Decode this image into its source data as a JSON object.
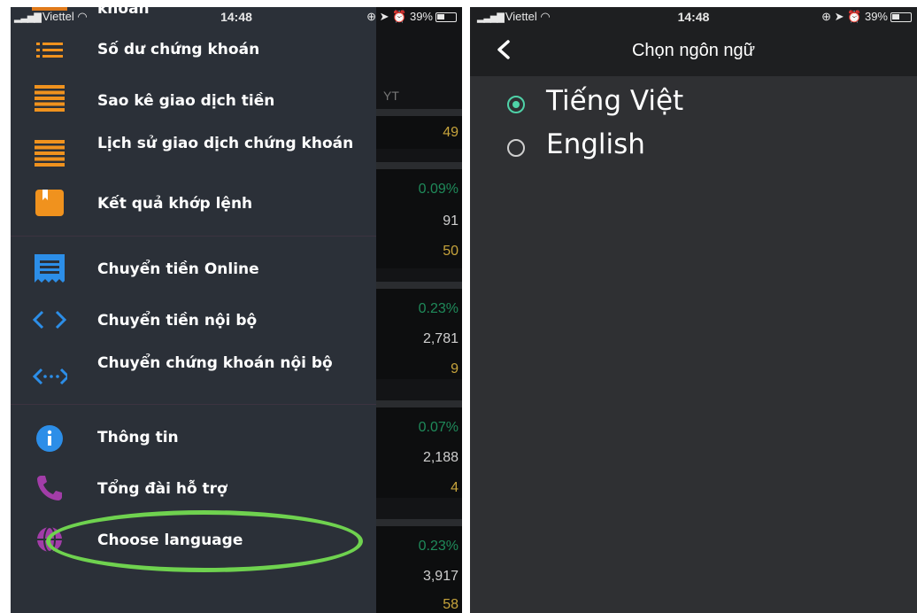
{
  "left": {
    "status": {
      "carrier": "Viettel",
      "time": "14:48",
      "battery": "39%"
    },
    "top_cut_text": "khoản",
    "stock_column": {
      "header": "YT",
      "values": [
        "49",
        "0.09%",
        "91",
        "50",
        "0.23%",
        "2,781",
        "9",
        "0.07%",
        "2,188",
        "4",
        "0.23%",
        "3,917",
        "58"
      ]
    },
    "menu": [
      {
        "label": "Số dư chứng khoán",
        "icon": "list-icon"
      },
      {
        "label": "Sao kê giao dịch tiền",
        "icon": "statement-icon"
      },
      {
        "label": "Lịch sử giao dịch chứng khoán",
        "icon": "history-icon"
      },
      {
        "label": "Kết quả khớp lệnh",
        "icon": "bookmark-icon"
      },
      {
        "label": "Chuyển tiền Online",
        "icon": "receipt-icon"
      },
      {
        "label": "Chuyển tiền nội bộ",
        "icon": "code-arrows-icon"
      },
      {
        "label": "Chuyển chứng khoán nội bộ",
        "icon": "dotted-arrows-icon"
      },
      {
        "label": "Thông tin",
        "icon": "info-icon"
      },
      {
        "label": "Tổng đài hỗ trợ",
        "icon": "phone-icon"
      },
      {
        "label": "Choose language",
        "icon": "globe-icon"
      }
    ],
    "highlight_color": "#6fd24f"
  },
  "right": {
    "status": {
      "carrier": "Viettel",
      "time": "14:48",
      "battery": "39%"
    },
    "title": "Chọn ngôn ngữ",
    "options": [
      {
        "label": "Tiếng Việt",
        "selected": true
      },
      {
        "label": "English",
        "selected": false
      }
    ],
    "accent": "#4fd2a8"
  }
}
